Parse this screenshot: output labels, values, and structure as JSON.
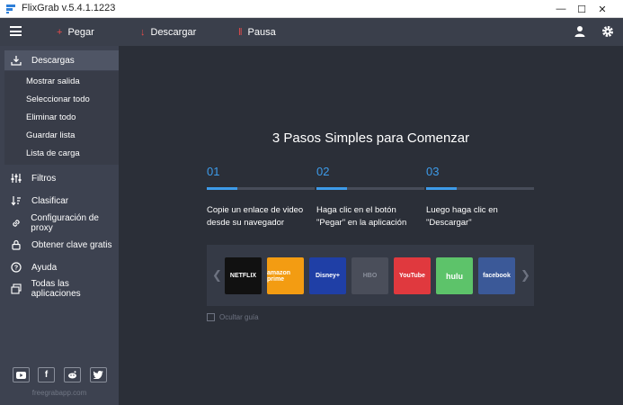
{
  "window": {
    "title": "FlixGrab  v.5.4.1.1223",
    "minimize": "—",
    "maximize": "☐",
    "close": "✕"
  },
  "toolbar": {
    "paste_label": "Pegar",
    "download_label": "Descargar",
    "pause_label": "Pausa",
    "paste_color": "#e84b4b",
    "download_color": "#e84b4b"
  },
  "sidebar": {
    "downloads_label": "Descargas",
    "submenu": [
      "Mostrar salida",
      "Seleccionar todo",
      "Eliminar todo",
      "Guardar lista",
      "Lista de carga"
    ],
    "items": [
      {
        "label": "Filtros",
        "icon": "sliders-icon"
      },
      {
        "label": "Clasificar",
        "icon": "sort-icon"
      },
      {
        "label": "Configuración de proxy",
        "icon": "link-icon"
      },
      {
        "label": "Obtener clave gratis",
        "icon": "lock-icon"
      },
      {
        "label": "Ayuda",
        "icon": "help-icon"
      },
      {
        "label": "Todas las aplicaciones",
        "icon": "apps-icon"
      }
    ],
    "social": [
      "youtube-icon",
      "facebook-icon",
      "reddit-icon",
      "twitter-icon"
    ],
    "site": "freegrabapp.com"
  },
  "main": {
    "heading": "3 Pasos Simples para Comenzar",
    "steps": [
      {
        "num": "01",
        "text": "Copie un enlace de video\ndesde su navegador"
      },
      {
        "num": "02",
        "text": "Haga clic en el botón\n\"Pegar\" en la aplicación"
      },
      {
        "num": "03",
        "text": "Luego haga clic en\n\"Descargar\""
      }
    ],
    "services": [
      {
        "label": "NETFLIX",
        "color": "#111111"
      },
      {
        "label": "amazon prime",
        "color": "#f39c12"
      },
      {
        "label": "Disney+",
        "color": "#1f3fa6"
      },
      {
        "label": "HBO",
        "color": "#4a4e5a"
      },
      {
        "label": "YouTube",
        "color": "#e0393e"
      },
      {
        "label": "hulu",
        "color": "#5dc36a"
      },
      {
        "label": "facebook",
        "color": "#3b5998"
      }
    ],
    "hide_guide": "Ocultar guía"
  },
  "colors": {
    "accent": "#3d9be9",
    "background": "#2b2f38",
    "sidebar": "#3d4250",
    "toolbar": "#3a3f4b"
  }
}
